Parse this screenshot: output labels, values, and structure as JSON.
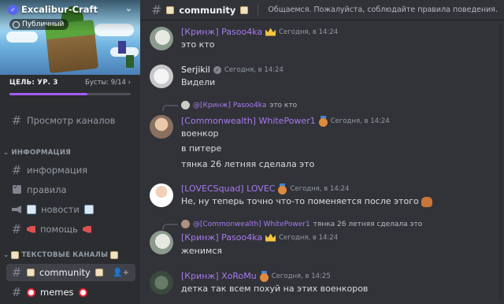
{
  "server": {
    "name": "Excalibur-Craft",
    "public_label": "Публичный",
    "level_label": "ЦЕЛЬ: УР. 3",
    "boosts_label": "Бусты: 9/14",
    "boost_progress": 0.64
  },
  "sidebar": {
    "browse_channels": "Просмотр каналов",
    "category_info": "ИНФОРМАЦИЯ",
    "category_text": "ТЕКСТОВЫЕ КАНАЛЫ",
    "channels": [
      {
        "label": "информация",
        "icon": "hash-icon"
      },
      {
        "label": "правила",
        "icon": "checkbox-icon"
      },
      {
        "label": "новости",
        "icon": "megaphone-icon"
      },
      {
        "label": "помощь",
        "icon": "hash-icon"
      },
      {
        "label": "community",
        "icon": "hash-icon"
      },
      {
        "label": "memes",
        "icon": "hash-icon"
      }
    ]
  },
  "header": {
    "channel_name": "community",
    "topic": "Общаемся. Пожалуйста, соблюдайте правила поведения."
  },
  "messages": [
    {
      "author": "[Кринж] Pasoo4ka",
      "timestamp": "Сегодня, в 14:24",
      "lines": [
        "это кто"
      ]
    },
    {
      "author": "Serjikil",
      "timestamp": "Сегодня, в 14:24",
      "lines": [
        "Видели"
      ]
    },
    {
      "reply_author": "@[Кринж] Pasoo4ka",
      "reply_text": "это кто",
      "author": "[Commonwealth] WhitePower1",
      "timestamp": "Сегодня, в 14:24",
      "lines": [
        "военкор",
        "в питере",
        "тянка 26 летняя сделала это"
      ]
    },
    {
      "author": "[LOVECSquad] LOVEC",
      "timestamp": "Сегодня, в 14:24",
      "lines": [
        "Не, ну теперь точно что-то поменяется после этого"
      ]
    },
    {
      "reply_author": "@[Commonwealth] WhitePower1",
      "reply_text": "тянка 26 летняя сделала это",
      "author": "[Кринж] Pasoo4ka",
      "timestamp": "Сегодня, в 14:24",
      "lines": [
        "женимся"
      ]
    },
    {
      "author": "[Кринж] XoRoMu",
      "timestamp": "Сегодня, в 14:25",
      "lines": [
        "детка так всем похуй на этих военкоров"
      ]
    }
  ],
  "colors": {
    "accent": "#5865f2",
    "role_name": "#a979f0",
    "boost_fill": "#a35cf5",
    "background": "#313338",
    "sidebar": "#2b2d31"
  }
}
